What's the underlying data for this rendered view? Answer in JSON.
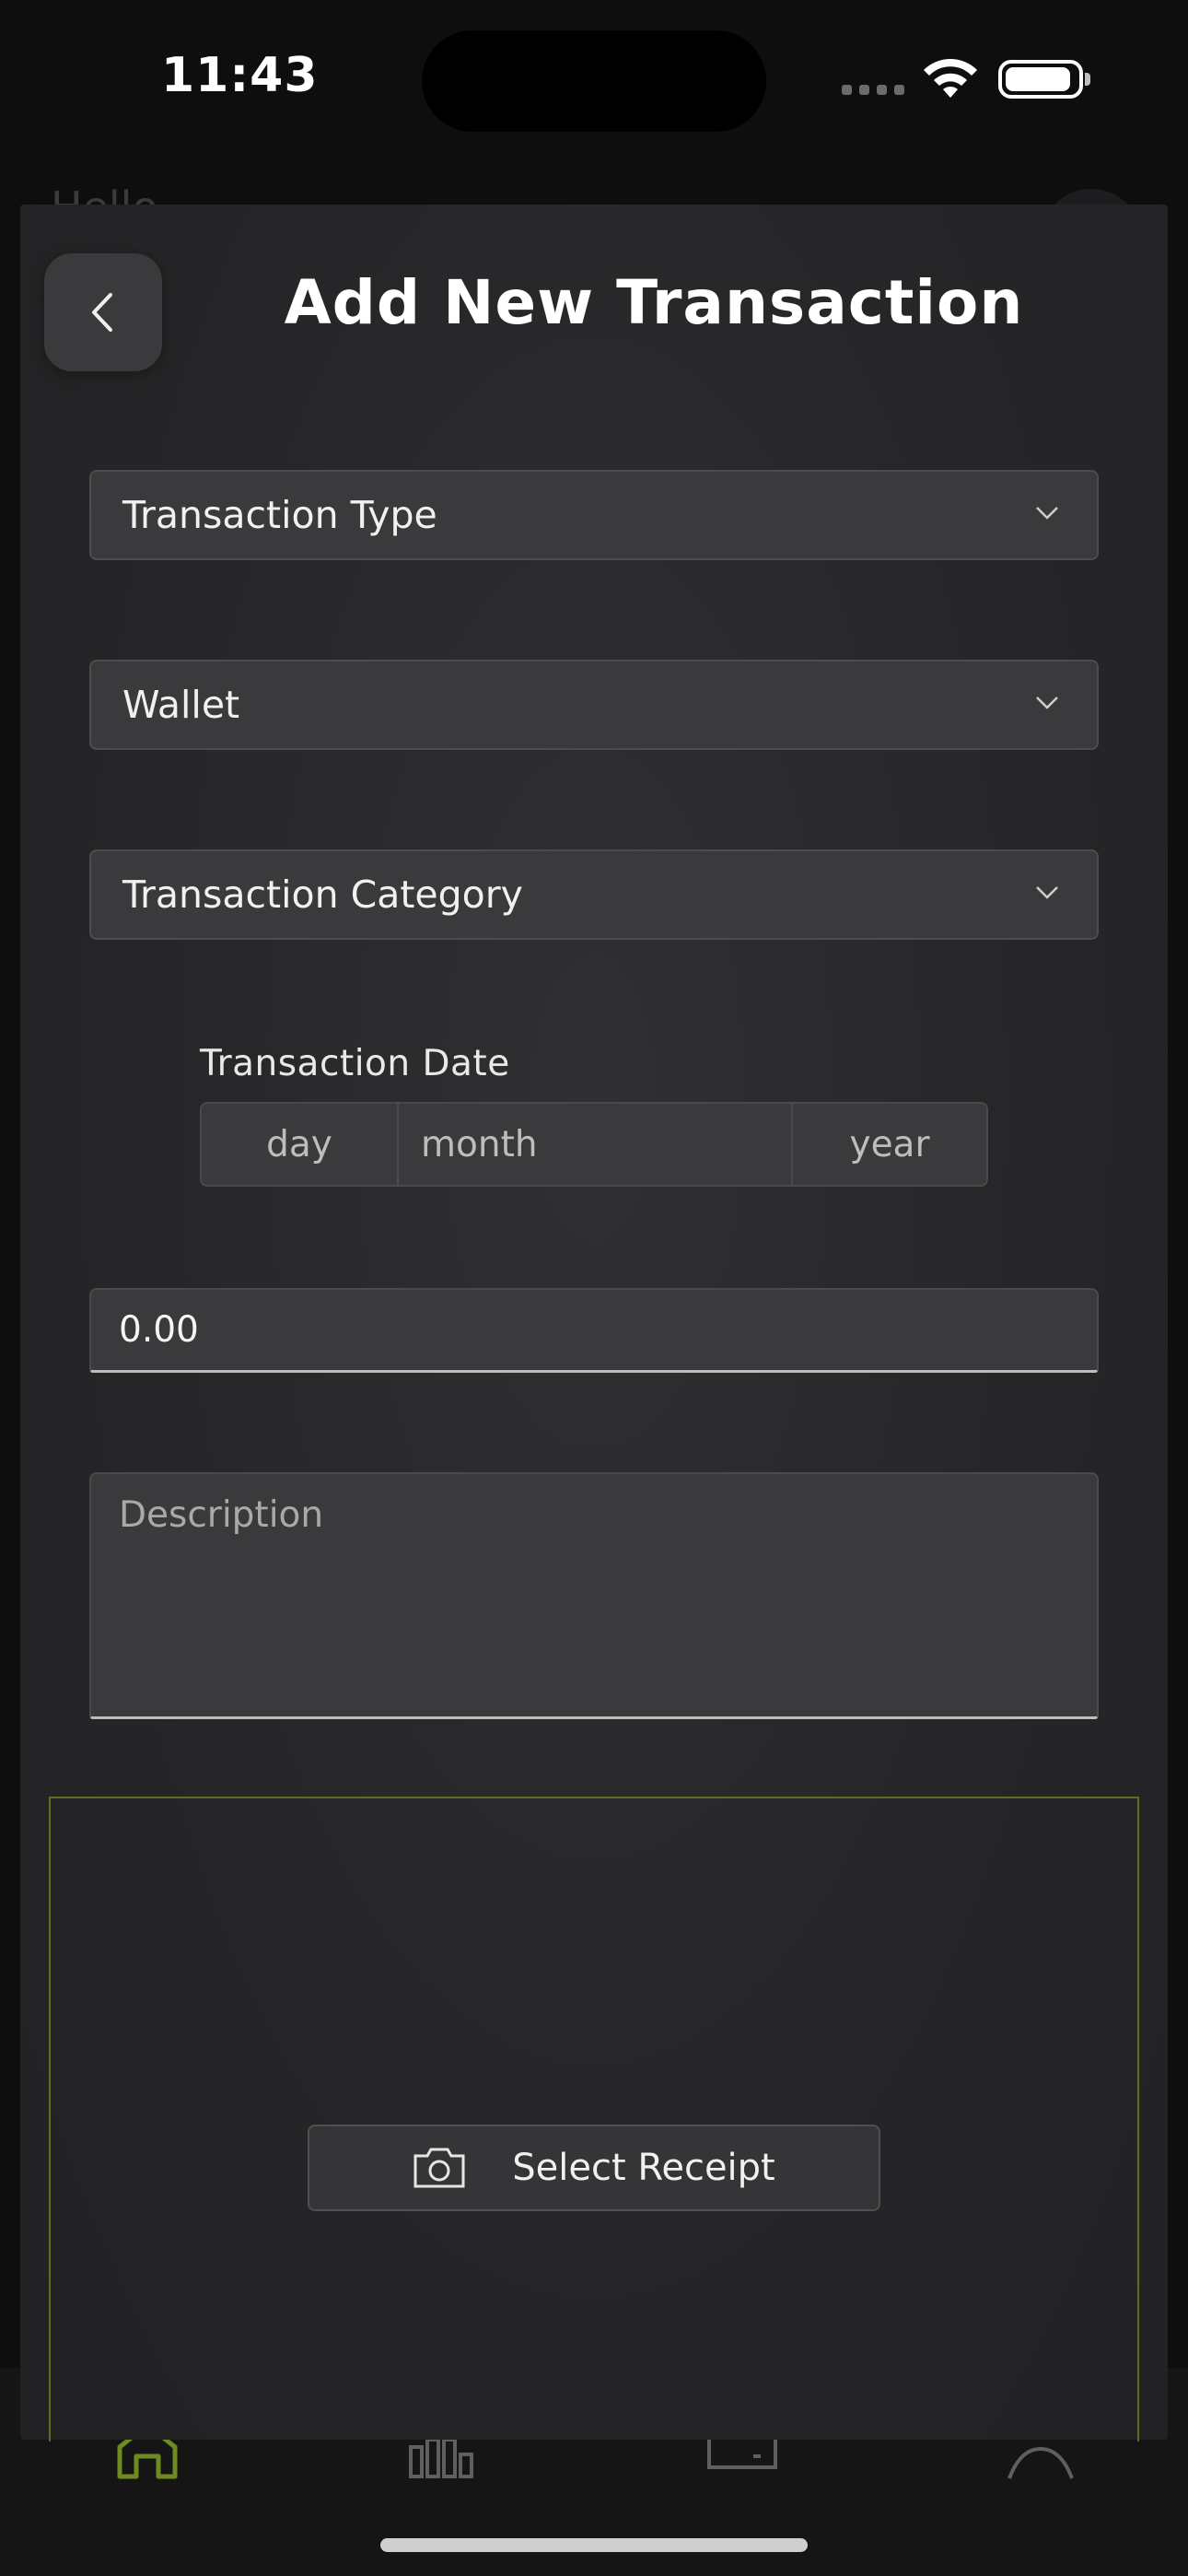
{
  "status_bar": {
    "time": "11:43"
  },
  "background": {
    "greeting": "Hello"
  },
  "form": {
    "title": "Add New Transaction",
    "transaction_type": {
      "label": "Transaction Type"
    },
    "wallet": {
      "label": "Wallet"
    },
    "transaction_category": {
      "label": "Transaction Category"
    },
    "transaction_date": {
      "label": "Transaction Date",
      "day_placeholder": "day",
      "month_placeholder": "month",
      "year_placeholder": "year"
    },
    "amount": {
      "value": "0.00"
    },
    "description": {
      "placeholder": "Description"
    },
    "receipt": {
      "button_label": "Select Receipt"
    }
  },
  "tab_bar": {
    "items": [
      {
        "icon": "home-icon",
        "active": true
      },
      {
        "icon": "stats-icon",
        "active": false
      },
      {
        "icon": "wallet-icon",
        "active": false
      },
      {
        "icon": "profile-icon",
        "active": false
      }
    ]
  },
  "colors": {
    "accent": "#6f8a1f",
    "sheet": "#2a2a2c",
    "field": "#3a3a3c"
  }
}
